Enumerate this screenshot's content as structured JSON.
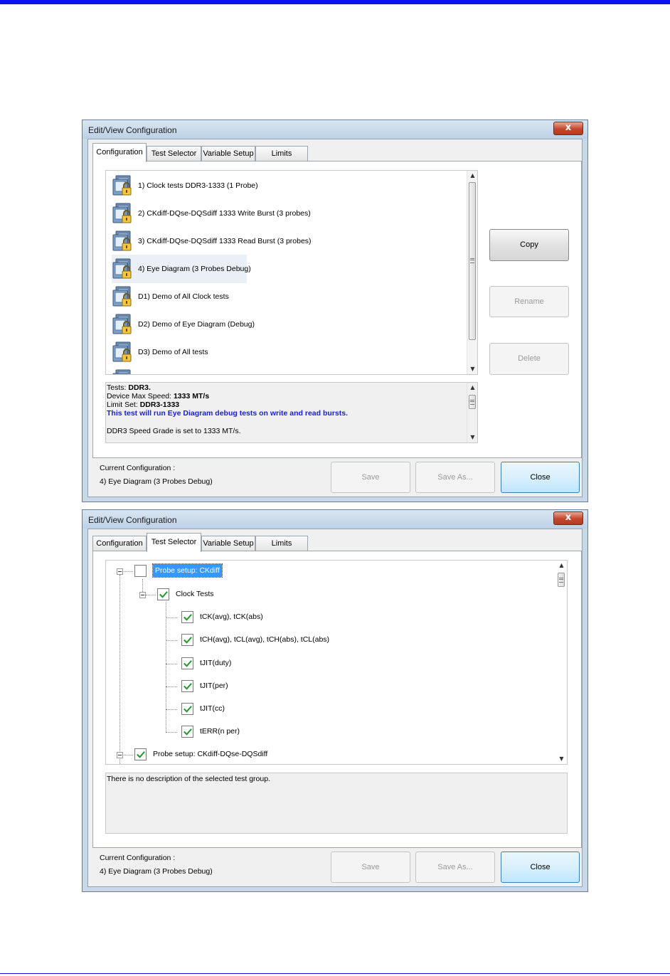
{
  "dialogs": [
    {
      "title": "Edit/View Configuration",
      "close_glyph": "x",
      "tabs": [
        "Configuration",
        "Test Selector",
        "Variable Setup",
        "Limits"
      ],
      "active_tab": "Configuration",
      "configurations": [
        {
          "label": "1) Clock tests DDR3-1333 (1 Probe)",
          "icon": "locked-config-icon"
        },
        {
          "label": "2) CKdiff-DQse-DQSdiff 1333 Write Burst (3 probes)",
          "icon": "locked-config-icon"
        },
        {
          "label": "3) CKdiff-DQse-DQSdiff 1333 Read Burst (3 probes)",
          "icon": "locked-config-icon"
        },
        {
          "label": "4) Eye Diagram (3 Probes Debug)",
          "icon": "locked-config-icon",
          "selected": true
        },
        {
          "label": "D1) Demo of All Clock tests",
          "icon": "locked-config-icon"
        },
        {
          "label": "D2) Demo of Eye Diagram (Debug)",
          "icon": "locked-config-icon"
        },
        {
          "label": "D3) Demo of All tests",
          "icon": "locked-config-icon"
        }
      ],
      "description": {
        "tests_label": "Tests:",
        "tests_value": "DDR3.",
        "speed_label": "Device Max Speed:",
        "speed_value": "1333 MT/s",
        "limit_label": "Limit Set:",
        "limit_value": "DDR3-1333",
        "highlight": "This test will run Eye Diagram debug tests on write and read bursts.",
        "note": "DDR3 Speed Grade is set to 1333 MT/s."
      },
      "side_buttons": {
        "copy": "Copy",
        "rename": "Rename",
        "delete": "Delete"
      },
      "footer": {
        "current_label": "Current Configuration :",
        "current_value": "4) Eye Diagram (3 Probes Debug)",
        "save": "Save",
        "save_as": "Save As...",
        "close": "Close"
      }
    },
    {
      "title": "Edit/View Configuration",
      "close_glyph": "x",
      "tabs": [
        "Configuration",
        "Test Selector",
        "Variable Setup",
        "Limits"
      ],
      "active_tab": "Test Selector",
      "tree": {
        "group1": {
          "label": "Probe setup: CKdiff",
          "checked": false,
          "selected": true
        },
        "subgroup": {
          "label": "Clock Tests",
          "checked": true
        },
        "tests": [
          {
            "label": "tCK(avg), tCK(abs)",
            "checked": true
          },
          {
            "label": "tCH(avg), tCL(avg), tCH(abs), tCL(abs)",
            "checked": true
          },
          {
            "label": "tJIT(duty)",
            "checked": true
          },
          {
            "label": "tJIT(per)",
            "checked": true
          },
          {
            "label": "tJIT(cc)",
            "checked": true
          },
          {
            "label": "tERR(n per)",
            "checked": true
          }
        ],
        "group2": {
          "label": "Probe setup: CKdiff-DQse-DQSdiff",
          "checked": true
        }
      },
      "description": "There is no description of the selected test group.",
      "footer": {
        "current_label": "Current Configuration :",
        "current_value": "4) Eye Diagram (3 Probes Debug)",
        "save": "Save",
        "save_as": "Save As...",
        "close": "Close"
      }
    }
  ]
}
